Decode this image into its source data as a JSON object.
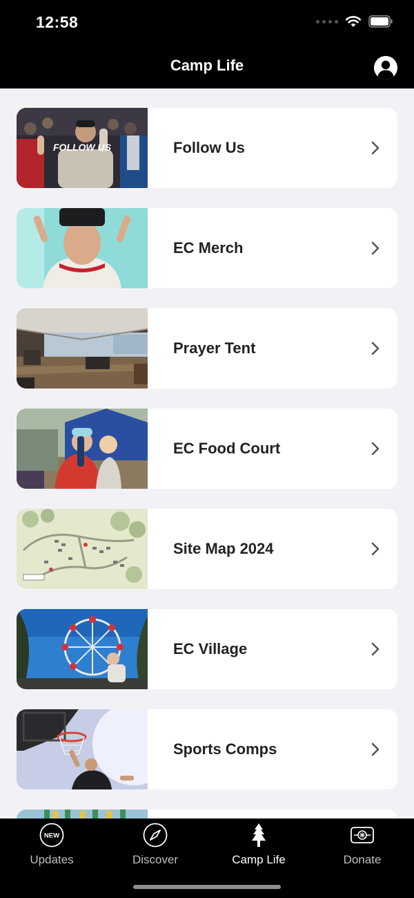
{
  "status": {
    "time": "12:58"
  },
  "nav": {
    "title": "Camp Life",
    "profile_icon": "person-circle-icon"
  },
  "items": [
    {
      "label": "Follow Us",
      "image_text": "FOLLOW US",
      "thumb": "crowd-photo"
    },
    {
      "label": "EC Merch",
      "thumb": "beanie-photo"
    },
    {
      "label": "Prayer Tent",
      "thumb": "tent-interior-photo"
    },
    {
      "label": "EC Food Court",
      "thumb": "food-court-photo"
    },
    {
      "label": "Site Map 2024",
      "thumb": "site-map-image"
    },
    {
      "label": "EC Village",
      "thumb": "ferris-wheel-photo"
    },
    {
      "label": "Sports Comps",
      "thumb": "basketball-photo"
    },
    {
      "label": "",
      "thumb": "partial-photo"
    }
  ],
  "tabs": [
    {
      "label": "Updates",
      "icon": "new-badge-icon",
      "active": false,
      "badge": "NEW"
    },
    {
      "label": "Discover",
      "icon": "compass-icon",
      "active": false
    },
    {
      "label": "Camp Life",
      "icon": "pine-tree-icon",
      "active": true
    },
    {
      "label": "Donate",
      "icon": "card-icon",
      "active": false
    }
  ],
  "colors": {
    "bar_bg": "#000000",
    "page_bg": "#f2f2f6",
    "card_bg": "#ffffff",
    "text": "#222222",
    "tab_inactive": "#bdbdbd",
    "tab_active": "#ffffff"
  }
}
